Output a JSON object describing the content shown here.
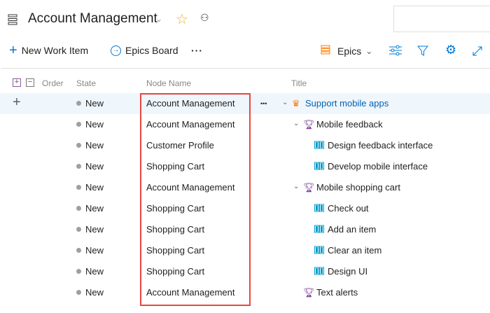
{
  "header": {
    "title": "Account Management"
  },
  "toolbar": {
    "new_work_item": "New Work Item",
    "epics_board": "Epics Board",
    "more": "···",
    "level": "Epics"
  },
  "columns": {
    "order": "Order",
    "state": "State",
    "node_name": "Node Name",
    "title": "Title"
  },
  "rows": [
    {
      "state": "New",
      "node": "Account Management",
      "title": "Support mobile apps",
      "level": 0,
      "type": "epic",
      "expand": true
    },
    {
      "state": "New",
      "node": "Account Management",
      "title": "Mobile feedback",
      "level": 1,
      "type": "feature",
      "expand": true
    },
    {
      "state": "New",
      "node": "Customer Profile",
      "title": "Design feedback interface",
      "level": 2,
      "type": "story",
      "expand": false
    },
    {
      "state": "New",
      "node": "Shopping Cart",
      "title": "Develop mobile interface",
      "level": 2,
      "type": "story",
      "expand": false
    },
    {
      "state": "New",
      "node": "Account Management",
      "title": "Mobile shopping cart",
      "level": 1,
      "type": "feature",
      "expand": true
    },
    {
      "state": "New",
      "node": "Shopping Cart",
      "title": "Check out",
      "level": 2,
      "type": "story",
      "expand": false
    },
    {
      "state": "New",
      "node": "Shopping Cart",
      "title": "Add an item",
      "level": 2,
      "type": "story",
      "expand": false
    },
    {
      "state": "New",
      "node": "Shopping Cart",
      "title": "Clear an item",
      "level": 2,
      "type": "story",
      "expand": false
    },
    {
      "state": "New",
      "node": "Shopping Cart",
      "title": "Design UI",
      "level": 2,
      "type": "story",
      "expand": false
    },
    {
      "state": "New",
      "node": "Account Management",
      "title": "Text alerts",
      "level": 1,
      "type": "feature",
      "expand": false
    }
  ],
  "row_more": "•••",
  "colors": {
    "accent": "#0078d4",
    "epic": "#ff7b00",
    "feature": "#773b93",
    "story": "#009ccc",
    "highlight": "#e8473f"
  }
}
